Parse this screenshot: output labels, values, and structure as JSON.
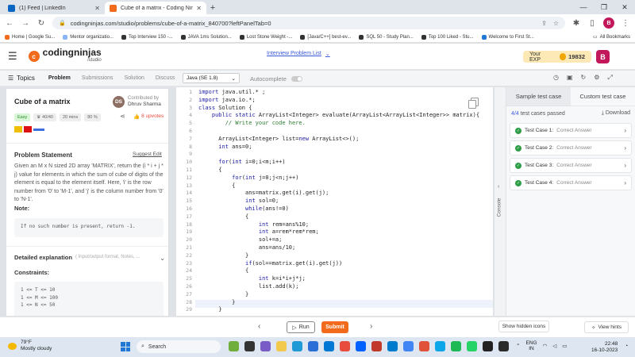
{
  "browser": {
    "tabs": [
      {
        "title": "(1) Feed | LinkedIn",
        "color": "#0a66c2"
      },
      {
        "title": "Cube of a matrix - Coding Ninja",
        "color": "#f26b1d"
      }
    ],
    "url": "codingninjas.com/studio/problems/cube-of-a-matrix_840700?leftPanelTab=0",
    "bookmarks": [
      "Home | Google Su...",
      "Mentor organizatio...",
      "Top Interview 150 -...",
      "JAVA 1ms Solution...",
      "Lost Stone Weight -...",
      "[Java/C++] best-ev...",
      "SQL 50 - Study Plan...",
      "Top 100 Liked - Stu...",
      "Welcome to First St..."
    ],
    "all_bookmarks": "All Bookmarks",
    "profile_initial": "B"
  },
  "header": {
    "logo_main": "codingninjas",
    "logo_sub": "/studio",
    "interview_list": "Interview Problem List",
    "exp_label": "Your EXP",
    "exp_value": "19832",
    "avatar": "B"
  },
  "toolbar": {
    "topics": "Topics",
    "tabs": [
      "Problem",
      "Submissions",
      "Solution",
      "Discuss"
    ],
    "language": "Java (SE 1.8)",
    "autocomplete": "Autocomplete"
  },
  "problem": {
    "title": "Cube of a matrix",
    "contributor_label": "Contributed by",
    "contributor": "Dhruv Sharma",
    "contributor_initials": "DS",
    "difficulty": "Easy",
    "score": "40/40",
    "time": "20 mins",
    "success": "80 %",
    "upvotes": "8 upvotes",
    "statement_heading": "Problem Statement",
    "suggest_edit": "Suggest Edit",
    "statement": "Given an M x N sized 2D array 'MATRIX', return the (i * i + j * j) value for elements in which the sum of cube of digits of the element is equal to the element itself. Here, 'i' is the row number from '0' to 'M-1', and 'j' is the column number from '0' to 'N-1'.",
    "note_heading": "Note:",
    "note_text": "If no such number is present, return -1.",
    "detailed_heading": "Detailed explanation",
    "detailed_hint": "( Input/output format, Notes, ...",
    "constraints_heading": "Constraints:",
    "constraints": [
      "1 <= T <= 10",
      "1 <= M <= 100",
      "1 <= N <= 50"
    ]
  },
  "editor": {
    "lines": [
      "import java.util.* ;",
      "import java.io.*;",
      "class Solution {",
      "    public static ArrayList<Integer> evaluate(ArrayList<ArrayList<Integer>> matrix){",
      "        // Write your code here.",
      "",
      "      ArrayList<Integer> list=new ArrayList<>();",
      "      int ans=0;",
      "",
      "      for(int i=0;i<m;i++)",
      "      {",
      "          for(int j=0;j<n;j++)",
      "          {",
      "              ans=matrix.get(i).get(j);",
      "              int sol=0;",
      "              while(ans!=0)",
      "              {",
      "                  int rem=ans%10;",
      "                  int a=rem*rem*rem;",
      "                  sol+=a;",
      "                  ans=ans/10;",
      "              }",
      "              if(sol==matrix.get(i).get(j))",
      "              {",
      "                  int k=i*i+j*j;",
      "                  list.add(k);",
      "              }",
      "          }",
      "      }"
    ],
    "line_numbers": [
      "1",
      "2",
      "3",
      "4",
      "5",
      "6",
      "7",
      "8",
      "9",
      "10",
      "11",
      "12",
      "13",
      "14",
      "15",
      "16",
      "17",
      "18",
      "19",
      "20",
      "21",
      "22",
      "23",
      "24",
      "25",
      "26",
      "27",
      "28",
      "29"
    ]
  },
  "console": {
    "label": "Console"
  },
  "tests": {
    "tabs": [
      "Sample test case",
      "Custom test case"
    ],
    "passed_count": "4/4",
    "passed_label": "test cases passed",
    "download": "Download",
    "cases": [
      {
        "name": "Test Case 1:",
        "status": "Correct Answer"
      },
      {
        "name": "Test Case 2:",
        "status": "Correct Answer"
      },
      {
        "name": "Test Case 3:",
        "status": "Correct Answer"
      },
      {
        "name": "Test Case 4:",
        "status": "Correct Answer"
      }
    ]
  },
  "bottom": {
    "run": "Run",
    "submit": "Submit",
    "show_hidden": "Show hidden icons",
    "view_hints": "View hints"
  },
  "taskbar": {
    "temp": "79°F",
    "weather": "Mostly cloudy",
    "search": "Search",
    "lang_top": "ENG",
    "lang_bottom": "IN",
    "time": "22:48",
    "date": "16-10-2023"
  }
}
